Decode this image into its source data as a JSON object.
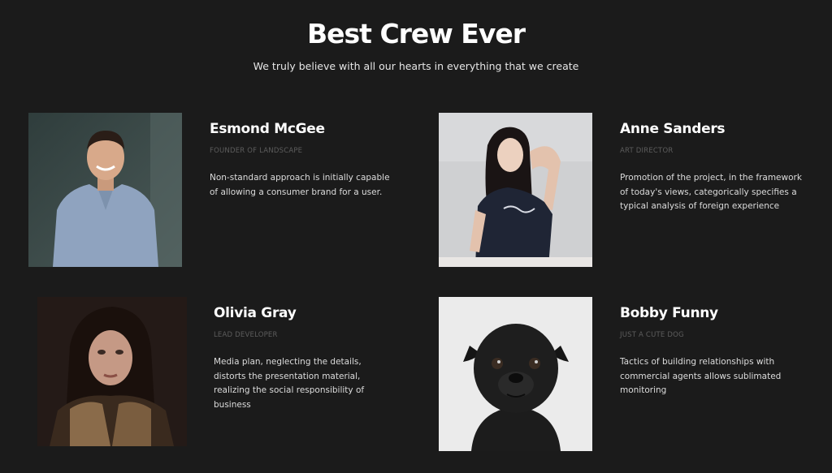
{
  "header": {
    "title": "Best Crew Ever",
    "subtitle": "We truly believe with all our hearts in everything that we create"
  },
  "members": [
    {
      "name": "Esmond McGee",
      "role": "Founder of Landscape",
      "description": "Non-standard approach is initially capable of allowing a consumer brand for a user."
    },
    {
      "name": "Anne Sanders",
      "role": "Art Director",
      "description": "Promotion of the project, in the framework of today's views, categorically specifies a typical analysis of foreign experience"
    },
    {
      "name": "Olivia Gray",
      "role": "Lead Developer",
      "description": "Media plan, neglecting the details, distorts the presentation material, realizing the social responsibility of business"
    },
    {
      "name": "Bobby Funny",
      "role": "Just a cute dog",
      "description": "Tactics of building relationships with commercial agents allows sublimated monitoring"
    }
  ]
}
